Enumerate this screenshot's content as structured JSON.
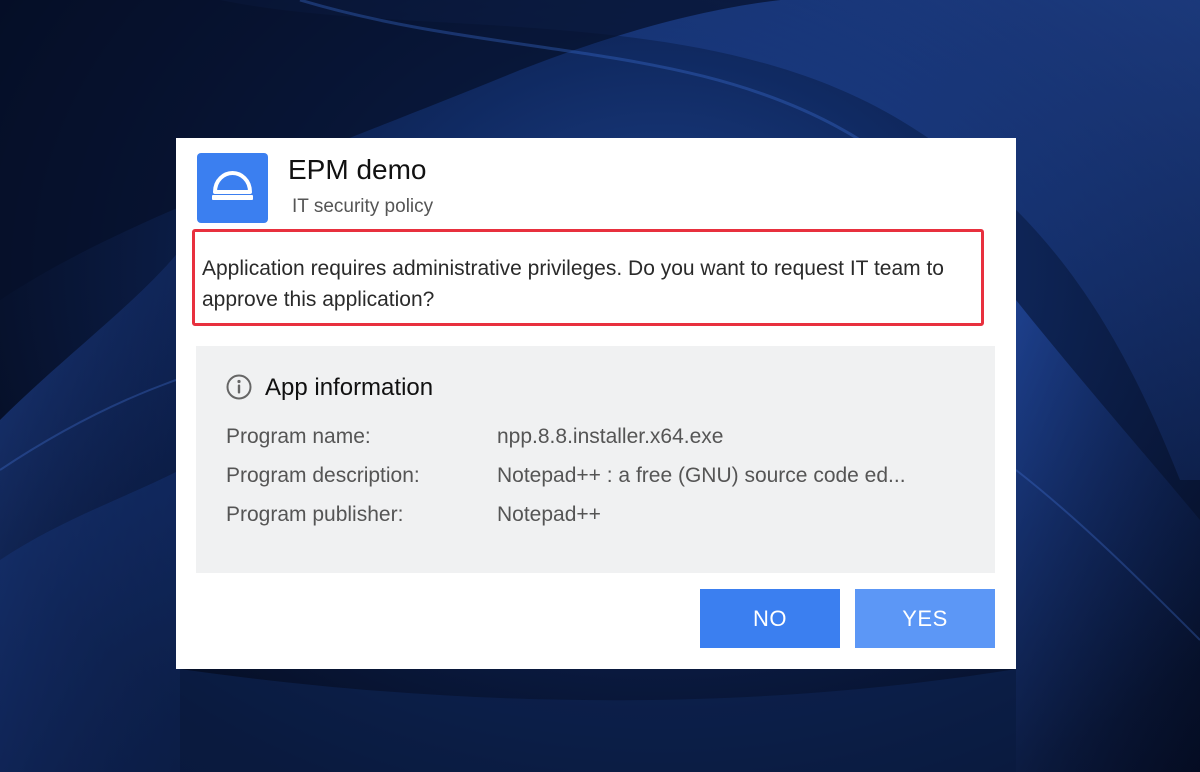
{
  "dialog": {
    "title": "EPM demo",
    "subtitle": "IT security policy",
    "message": "Application requires administrative privileges. Do you want to request IT team to approve this application?",
    "app_icon": "helmet-icon"
  },
  "app_info": {
    "heading": "App information",
    "heading_icon": "info-icon",
    "rows": [
      {
        "label": "Program name:",
        "value": "npp.8.8.installer.x64.exe"
      },
      {
        "label": "Program description:",
        "value": "Notepad++ : a free (GNU) source code ed..."
      },
      {
        "label": "Program publisher:",
        "value": "Notepad++"
      }
    ]
  },
  "buttons": {
    "no_label": "NO",
    "yes_label": "YES"
  },
  "colors": {
    "accent": "#3b7ff0",
    "accent_light": "#5c97f6",
    "highlight_border": "#e8303e",
    "panel_background": "#f0f1f2"
  }
}
